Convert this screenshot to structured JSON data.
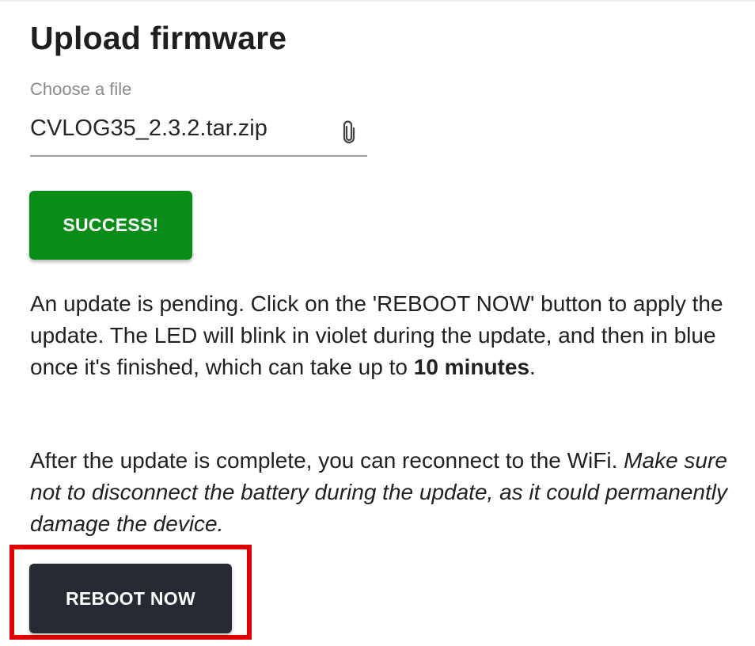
{
  "upload": {
    "title": "Upload firmware",
    "file_label": "Choose a file",
    "file_value": "CVLOG35_2.3.2.tar.zip",
    "attach_icon": "paperclip-icon"
  },
  "status": {
    "success_label": "SUCCESS!",
    "success_color": "#0a8c18"
  },
  "info": {
    "para1_text": "An update is pending. Click on the 'REBOOT NOW' button to apply the update. The LED will blink in violet during the update, and then in blue once it's finished, which can take up to ",
    "para1_bold": "10 minutes",
    "para1_end": ".",
    "para2_text": "After the update is complete, you can reconnect to the WiFi. ",
    "para2_italic": "Make sure not to disconnect the battery during the update, as it could permanently damage the device."
  },
  "action": {
    "reboot_label": "REBOOT NOW",
    "reboot_color": "#262b33",
    "highlight_color": "#e10000"
  }
}
